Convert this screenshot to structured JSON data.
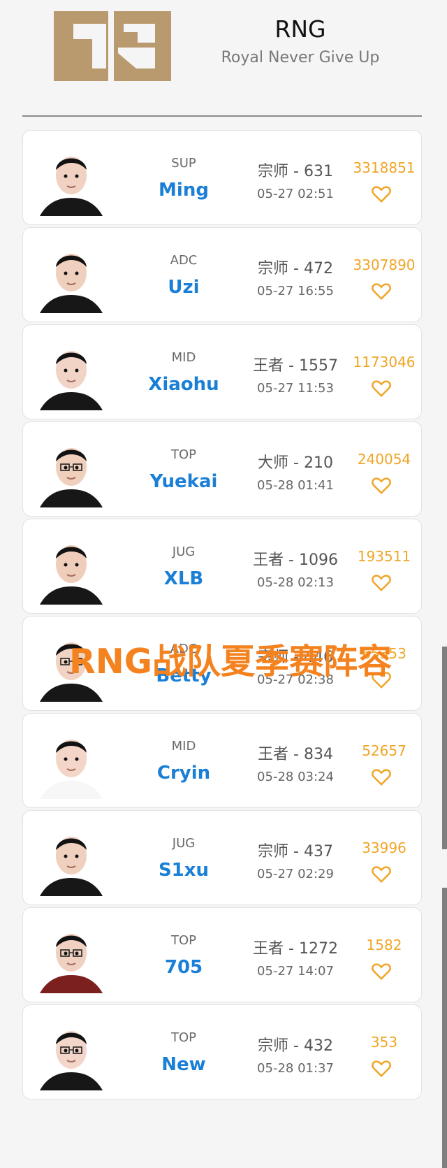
{
  "header": {
    "title": "RNG",
    "subtitle": "Royal Never Give Up",
    "logo_color": "#b89a6e",
    "logo_letters": "R"
  },
  "players": [
    {
      "position": "SUP",
      "name": "Ming",
      "rank": "宗师 - 631",
      "time": "05-27 02:51",
      "score": "3318851"
    },
    {
      "position": "ADC",
      "name": "Uzi",
      "rank": "宗师 - 472",
      "time": "05-27 16:55",
      "score": "3307890"
    },
    {
      "position": "MID",
      "name": "Xiaohu",
      "rank": "王者 - 1557",
      "time": "05-27 11:53",
      "score": "1173046"
    },
    {
      "position": "TOP",
      "name": "Yuekai",
      "rank": "大师 - 210",
      "time": "05-28 01:41",
      "score": "240054"
    },
    {
      "position": "JUG",
      "name": "XLB",
      "rank": "王者 - 1096",
      "time": "05-28 02:13",
      "score": "193511"
    },
    {
      "position": "ADC",
      "name": "Betty",
      "rank": "宗师 - 446",
      "time": "05-27 02:38",
      "score": "65353"
    },
    {
      "position": "MID",
      "name": "Cryin",
      "rank": "王者 - 834",
      "time": "05-28 03:24",
      "score": "52657"
    },
    {
      "position": "JUG",
      "name": "S1xu",
      "rank": "宗师 - 437",
      "time": "05-27 02:29",
      "score": "33996"
    },
    {
      "position": "TOP",
      "name": "705",
      "rank": "王者 - 1272",
      "time": "05-27 14:07",
      "score": "1582"
    },
    {
      "position": "TOP",
      "name": "New",
      "rank": "宗师 - 432",
      "time": "05-28 01:37",
      "score": "353"
    }
  ],
  "overlay_caption": "RNG战队夏季赛阵容",
  "colors": {
    "name_blue": "#1a7fd6",
    "score_orange": "#f0a526",
    "overlay_orange": "#f4821f"
  },
  "icons": {
    "like": "heart-outline-icon",
    "avatar": "player-avatar"
  }
}
